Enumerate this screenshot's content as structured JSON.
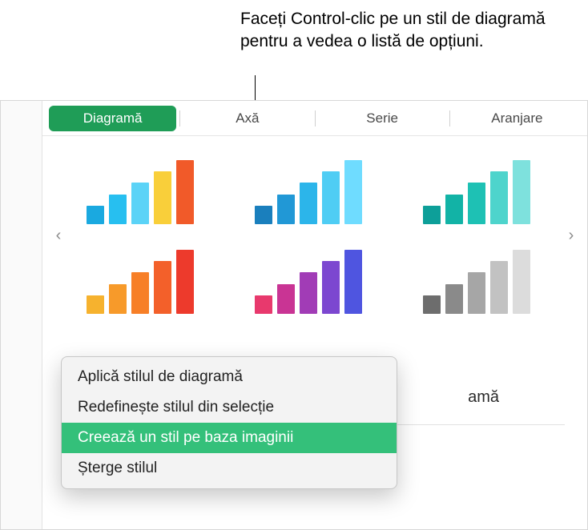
{
  "callout": {
    "text": "Faceți Control-clic pe un stil de diagramă pentru a vedea o listă de opțiuni."
  },
  "tabs": {
    "chart": "Diagramă",
    "axis": "Axă",
    "series": "Serie",
    "arrange": "Aranjare"
  },
  "truncated_options_label": "amă",
  "nav": {
    "prev": "‹",
    "next": "›"
  },
  "context_menu": {
    "apply": "Aplică stilul de diagramă",
    "redefine": "Redefinește stilul din selecție",
    "create": "Creează un stil pe baza imaginii",
    "delete": "Șterge stilul"
  },
  "chart_data": [
    {
      "type": "bar",
      "values": [
        26,
        42,
        58,
        74,
        90
      ],
      "colors": [
        "#1aa9e0",
        "#27bff0",
        "#5bd3f7",
        "#f9cf3a",
        "#f15a29"
      ]
    },
    {
      "type": "bar",
      "values": [
        26,
        42,
        58,
        74,
        90
      ],
      "colors": [
        "#1a7fbd",
        "#2198d6",
        "#2cb5ea",
        "#4fcdf4",
        "#6fdcff"
      ]
    },
    {
      "type": "bar",
      "values": [
        26,
        42,
        58,
        74,
        90
      ],
      "colors": [
        "#0d9f99",
        "#12b3a6",
        "#1ec1b4",
        "#4ed4cc",
        "#7ee1dd"
      ]
    },
    {
      "type": "bar",
      "values": [
        26,
        42,
        58,
        74,
        90
      ],
      "colors": [
        "#f6b22e",
        "#f79a2a",
        "#f77f27",
        "#f3602a",
        "#ed3a2c"
      ]
    },
    {
      "type": "bar",
      "values": [
        26,
        42,
        58,
        74,
        90
      ],
      "colors": [
        "#e8396d",
        "#c93494",
        "#a13cb6",
        "#7c47d0",
        "#4f55e0"
      ]
    },
    {
      "type": "bar",
      "values": [
        26,
        42,
        58,
        74,
        90
      ],
      "colors": [
        "#6d6d6d",
        "#8a8a8a",
        "#a6a6a6",
        "#c2c2c2",
        "#dcdcdc"
      ]
    }
  ]
}
